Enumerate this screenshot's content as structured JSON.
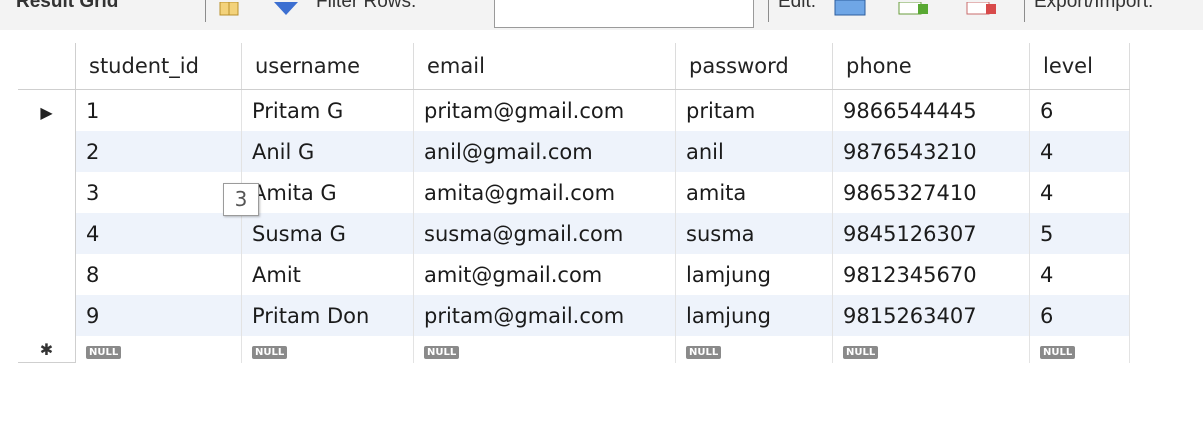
{
  "toolbar": {
    "result_grid_label": "Result Grid",
    "filter_rows_label": "Filter Rows:",
    "filter_rows_value": "",
    "edit_label": "Edit:",
    "export_label": "Export/Import:"
  },
  "grid": {
    "columns": [
      "student_id",
      "username",
      "email",
      "password",
      "phone",
      "level"
    ],
    "rows": [
      [
        "1",
        "Pritam G",
        "pritam@gmail.com",
        "pritam",
        "9866544445",
        "6"
      ],
      [
        "2",
        "Anil G",
        "anil@gmail.com",
        "anil",
        "9876543210",
        "4"
      ],
      [
        "3",
        "Amita G",
        "amita@gmail.com",
        "amita",
        "9865327410",
        "4"
      ],
      [
        "4",
        "Susma G",
        "susma@gmail.com",
        "susma",
        "9845126307",
        "5"
      ],
      [
        "8",
        "Amit",
        "amit@gmail.com",
        "lamjung",
        "9812345670",
        "4"
      ],
      [
        "9",
        "Pritam Don",
        "pritam@gmail.com",
        "lamjung",
        "9815263407",
        "6"
      ]
    ],
    "null_label": "NULL",
    "current_row_marker": "▶",
    "new_row_marker": "✱"
  },
  "tooltip": {
    "text": "3"
  },
  "icons": [
    "result-grid-icon",
    "filter-icon",
    "edit-form-icon",
    "add-row-icon",
    "delete-row-icon"
  ]
}
